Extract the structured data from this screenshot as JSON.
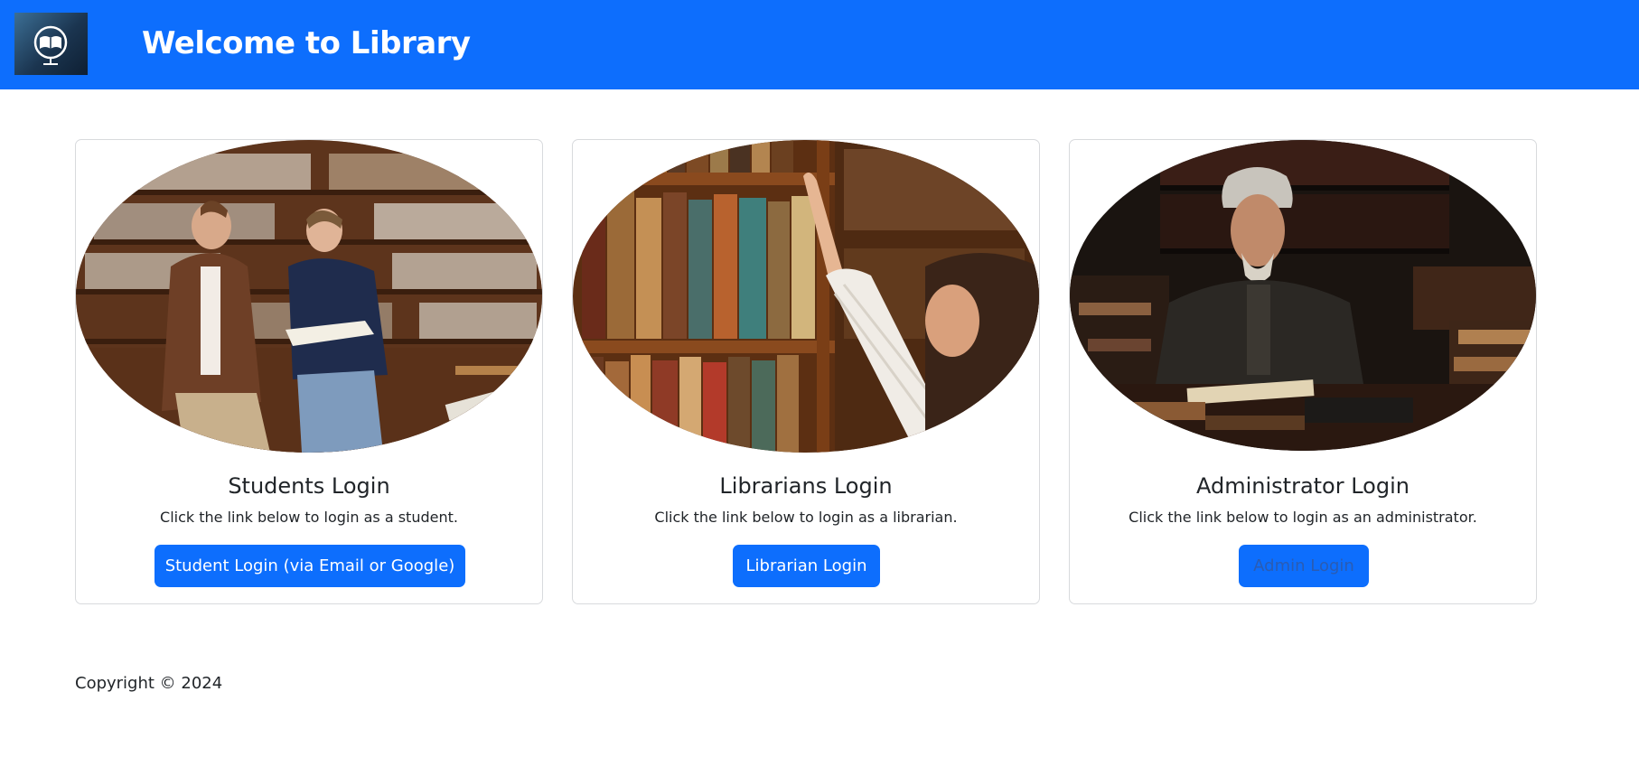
{
  "header": {
    "title": "Welcome to Library",
    "logo_icon": "library-book-globe-icon",
    "background_color": "#0d6efd"
  },
  "cards": [
    {
      "title": "Students Login",
      "text": "Click the link below to login as a student.",
      "button_label": "Student Login (via Email or Google)",
      "image": "students-reading-in-library-photo"
    },
    {
      "title": "Librarians Login",
      "text": "Click the link below to login as a librarian.",
      "button_label": "Librarian Login",
      "image": "librarian-reaching-bookshelf-photo"
    },
    {
      "title": "Administrator Login",
      "text": "Click the link below to login as an administrator.",
      "button_label": "Admin Login",
      "image": "administrator-at-desk-with-books-photo"
    }
  ],
  "footer": {
    "copyright": "Copyright © 2024"
  },
  "colors": {
    "primary": "#0d6efd",
    "card_border": "#d8dadd",
    "text": "#212529"
  }
}
